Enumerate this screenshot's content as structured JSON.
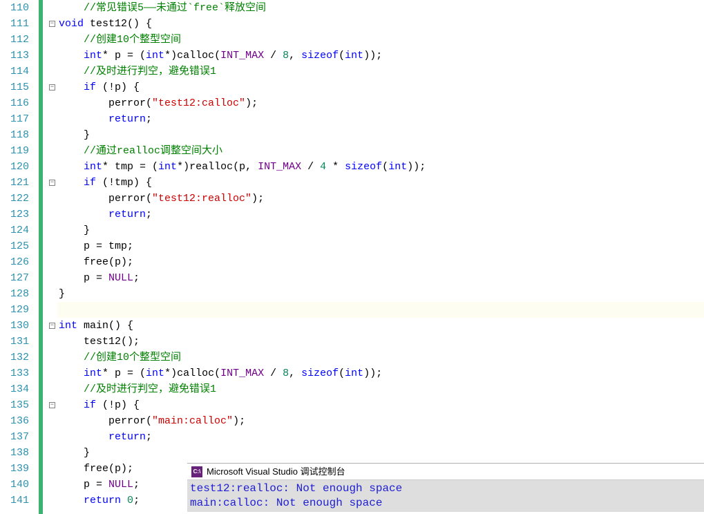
{
  "line_start": 110,
  "line_end": 141,
  "fold_lines": [
    111,
    115,
    121,
    130,
    135
  ],
  "code_lines": [
    [
      [
        "    ",
        "p"
      ],
      [
        "//常见错误5——未通过`free`释放空间",
        "cmt"
      ]
    ],
    [
      [
        "void",
        "kw"
      ],
      [
        " test12",
        "fn"
      ],
      [
        "() {",
        "p"
      ]
    ],
    [
      [
        "    ",
        "p"
      ],
      [
        "//创建10个整型空间",
        "cmt"
      ]
    ],
    [
      [
        "    ",
        "p"
      ],
      [
        "int",
        "type"
      ],
      [
        "* p = (",
        "p"
      ],
      [
        "int",
        "type"
      ],
      [
        "*)calloc(",
        "p"
      ],
      [
        "INT_MAX",
        "const"
      ],
      [
        " / ",
        "p"
      ],
      [
        "8",
        "num"
      ],
      [
        ", ",
        "p"
      ],
      [
        "sizeof",
        "kw"
      ],
      [
        "(",
        "p"
      ],
      [
        "int",
        "type"
      ],
      [
        "));",
        "p"
      ]
    ],
    [
      [
        "    ",
        "p"
      ],
      [
        "//及时进行判空，避免错误1",
        "cmt"
      ]
    ],
    [
      [
        "    ",
        "p"
      ],
      [
        "if",
        "kw"
      ],
      [
        " (!p) {",
        "p"
      ]
    ],
    [
      [
        "        perror(",
        "p"
      ],
      [
        "\"test12:calloc\"",
        "str"
      ],
      [
        ");",
        "p"
      ]
    ],
    [
      [
        "        ",
        "p"
      ],
      [
        "return",
        "kw"
      ],
      [
        ";",
        "p"
      ]
    ],
    [
      [
        "    }",
        "p"
      ]
    ],
    [
      [
        "    ",
        "p"
      ],
      [
        "//通过realloc调整空间大小",
        "cmt"
      ]
    ],
    [
      [
        "    ",
        "p"
      ],
      [
        "int",
        "type"
      ],
      [
        "* tmp = (",
        "p"
      ],
      [
        "int",
        "type"
      ],
      [
        "*)realloc(p, ",
        "p"
      ],
      [
        "INT_MAX",
        "const"
      ],
      [
        " / ",
        "p"
      ],
      [
        "4",
        "num"
      ],
      [
        " * ",
        "p"
      ],
      [
        "sizeof",
        "kw"
      ],
      [
        "(",
        "p"
      ],
      [
        "int",
        "type"
      ],
      [
        "));",
        "p"
      ]
    ],
    [
      [
        "    ",
        "p"
      ],
      [
        "if",
        "kw"
      ],
      [
        " (!tmp) {",
        "p"
      ]
    ],
    [
      [
        "        perror(",
        "p"
      ],
      [
        "\"test12:realloc\"",
        "str"
      ],
      [
        ");",
        "p"
      ]
    ],
    [
      [
        "        ",
        "p"
      ],
      [
        "return",
        "kw"
      ],
      [
        ";",
        "p"
      ]
    ],
    [
      [
        "    }",
        "p"
      ]
    ],
    [
      [
        "    p = tmp;",
        "p"
      ]
    ],
    [
      [
        "    free(p);",
        "p"
      ]
    ],
    [
      [
        "    p = ",
        "p"
      ],
      [
        "NULL",
        "const"
      ],
      [
        ";",
        "p"
      ]
    ],
    [
      [
        "}",
        "p"
      ]
    ],
    [
      [
        "",
        "p"
      ]
    ],
    [
      [
        "int",
        "type"
      ],
      [
        " main",
        "fn"
      ],
      [
        "() {",
        "p"
      ]
    ],
    [
      [
        "    test12();",
        "p"
      ]
    ],
    [
      [
        "    ",
        "p"
      ],
      [
        "//创建10个整型空间",
        "cmt"
      ]
    ],
    [
      [
        "    ",
        "p"
      ],
      [
        "int",
        "type"
      ],
      [
        "* p = (",
        "p"
      ],
      [
        "int",
        "type"
      ],
      [
        "*)calloc(",
        "p"
      ],
      [
        "INT_MAX",
        "const"
      ],
      [
        " / ",
        "p"
      ],
      [
        "8",
        "num"
      ],
      [
        ", ",
        "p"
      ],
      [
        "sizeof",
        "kw"
      ],
      [
        "(",
        "p"
      ],
      [
        "int",
        "type"
      ],
      [
        "));",
        "p"
      ]
    ],
    [
      [
        "    ",
        "p"
      ],
      [
        "//及时进行判空，避免错误1",
        "cmt"
      ]
    ],
    [
      [
        "    ",
        "p"
      ],
      [
        "if",
        "kw"
      ],
      [
        " (!p) {",
        "p"
      ]
    ],
    [
      [
        "        perror(",
        "p"
      ],
      [
        "\"main:calloc\"",
        "str"
      ],
      [
        ");",
        "p"
      ]
    ],
    [
      [
        "        ",
        "p"
      ],
      [
        "return",
        "kw"
      ],
      [
        ";",
        "p"
      ]
    ],
    [
      [
        "    }",
        "p"
      ]
    ],
    [
      [
        "    free(p);",
        "p"
      ]
    ],
    [
      [
        "    p = ",
        "p"
      ],
      [
        "NULL",
        "const"
      ],
      [
        ";",
        "p"
      ]
    ],
    [
      [
        "    ",
        "p"
      ],
      [
        "return",
        "kw"
      ],
      [
        " ",
        "p"
      ],
      [
        "0",
        "num"
      ],
      [
        ";",
        "p"
      ]
    ]
  ],
  "highlight_row": 129,
  "console": {
    "icon_text": "C:\\",
    "title": "Microsoft Visual Studio 调试控制台",
    "lines": [
      "test12:realloc: Not enough space",
      "main:calloc: Not enough space"
    ]
  }
}
